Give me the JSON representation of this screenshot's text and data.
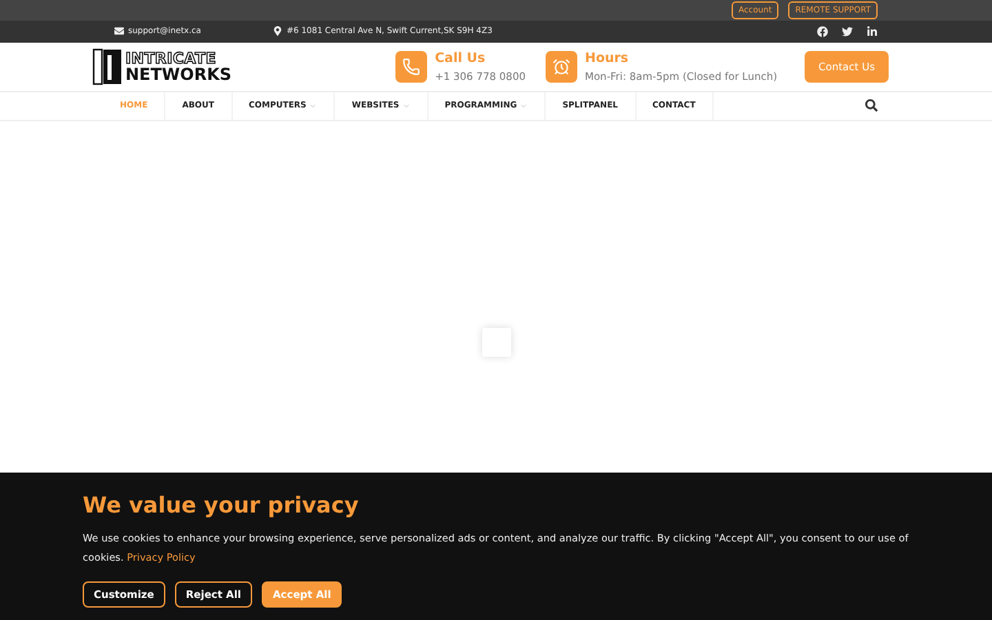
{
  "top_bar": {
    "buttons": [
      "Account",
      "REMOTE SUPPORT"
    ]
  },
  "info_bar": {
    "email": "support@inetx.ca",
    "address": "#6 1081 Central Ave N, Swift Current,SK S9H 4Z3",
    "social": [
      {
        "kind": "facebook"
      },
      {
        "kind": "twitter"
      },
      {
        "kind": "linkedin"
      }
    ]
  },
  "header": {
    "logo": {
      "line_1": "INTRICATE",
      "line_2": "NETWORKS"
    },
    "contacts": [
      {
        "kind": "phone",
        "title": "Call Us",
        "text": "+1 306 778 0800"
      },
      {
        "kind": "clock",
        "title": "Hours",
        "text": "Mon-Fri: 8am-5pm (Closed for Lunch)"
      }
    ],
    "cta": "Contact Us"
  },
  "nav": {
    "items": [
      {
        "label": "HOME",
        "selected": true,
        "has_menu": false
      },
      {
        "label": "ABOUT",
        "selected": false,
        "has_menu": false
      },
      {
        "label": "COMPUTERS",
        "selected": false,
        "has_menu": true
      },
      {
        "label": "WEBSITES",
        "selected": false,
        "has_menu": true
      },
      {
        "label": "PROGRAMMING",
        "selected": false,
        "has_menu": true
      },
      {
        "label": "SPLITPANEL",
        "selected": false,
        "has_menu": false
      },
      {
        "label": "CONTACT",
        "selected": false,
        "has_menu": false
      }
    ]
  },
  "cookie_banner": {
    "title": "We value your privacy",
    "text": "We use cookies to enhance your browsing experience, serve personalized ads or content, and analyze our traffic. By clicking \"Accept All\", you consent to our use of cookies.",
    "link": "Privacy Policy",
    "buttons": [
      {
        "label": "Customize",
        "kind": "outline"
      },
      {
        "label": "Reject All",
        "kind": "outline"
      },
      {
        "label": "Accept All",
        "kind": "filled"
      }
    ]
  }
}
